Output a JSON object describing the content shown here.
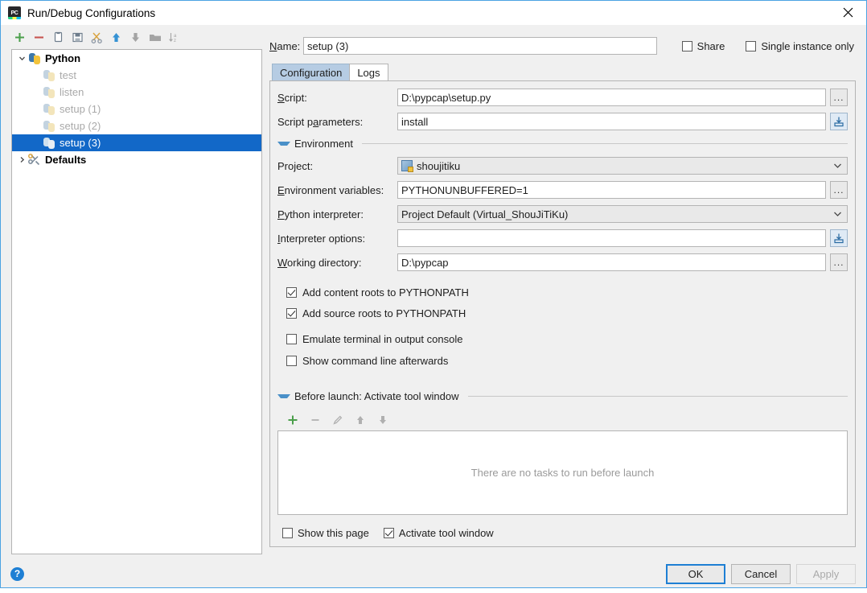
{
  "window": {
    "title": "Run/Debug Configurations",
    "app_icon": "pycharm-icon",
    "close_icon": "close-icon"
  },
  "tree_toolbar": {
    "items": [
      {
        "name": "add-configuration-button",
        "icon": "plus-icon",
        "color": "#4b9f4b",
        "enabled": true
      },
      {
        "name": "remove-configuration-button",
        "icon": "minus-icon",
        "color": "#c75450",
        "enabled": true
      },
      {
        "name": "copy-configuration-button",
        "icon": "copy-icon",
        "color": "#6e7d8c",
        "enabled": true
      },
      {
        "name": "save-configuration-button",
        "icon": "save-icon",
        "color": "#6e7d8c",
        "enabled": true
      },
      {
        "name": "edit-templates-button",
        "icon": "scissors-icon",
        "color": "#d9a441",
        "enabled": true
      },
      {
        "name": "move-up-button",
        "icon": "arrow-up-icon",
        "color": "#3592d4",
        "enabled": true
      },
      {
        "name": "move-down-button",
        "icon": "arrow-down-icon",
        "color": "#a4a4a4",
        "enabled": false
      },
      {
        "name": "move-into-folder-button",
        "icon": "folder-icon",
        "color": "#a4a4a4",
        "enabled": false
      },
      {
        "name": "sort-configurations-button",
        "icon": "sort-az-icon",
        "color": "#a4a4a4",
        "enabled": false
      }
    ]
  },
  "tree": {
    "nodes": [
      {
        "label": "Python",
        "type": "group",
        "expanded": true,
        "icon": "python-icon",
        "selected": false
      },
      {
        "label": "test",
        "type": "child",
        "icon": "python-icon",
        "selected": false
      },
      {
        "label": "listen",
        "type": "child",
        "icon": "python-icon",
        "selected": false
      },
      {
        "label": "setup (1)",
        "type": "child",
        "icon": "python-icon",
        "selected": false
      },
      {
        "label": "setup (2)",
        "type": "child",
        "icon": "python-icon",
        "selected": false
      },
      {
        "label": "setup (3)",
        "type": "child",
        "icon": "python-icon",
        "selected": true
      },
      {
        "label": "Defaults",
        "type": "group",
        "expanded": false,
        "icon": "wrench-icon",
        "selected": false
      }
    ]
  },
  "name_row": {
    "label": "Name:",
    "value": "setup (3)",
    "placeholder": "",
    "share": {
      "label": "Share",
      "checked": false
    },
    "single_instance": {
      "label": "Single instance only",
      "checked": false
    }
  },
  "tabs": [
    {
      "label": "Configuration",
      "active": true
    },
    {
      "label": "Logs",
      "active": false
    }
  ],
  "fields": {
    "script": {
      "label": "Script:",
      "value": "D:\\pypcap\\setup.py",
      "browse_icon": "ellipsis-icon",
      "browse_label": "..."
    },
    "script_parameters": {
      "label": "Script parameters:",
      "value": "install",
      "macro_icon": "expand-macros-icon"
    },
    "environment_section": {
      "label": "Environment",
      "expanded": true,
      "toggle_icon": "triangle-down-icon"
    },
    "project": {
      "label": "Project:",
      "value": "shoujitiku",
      "icon": "project-icon",
      "caret_icon": "chevron-down-icon"
    },
    "environment_variables": {
      "label": "Environment variables:",
      "value": "PYTHONUNBUFFERED=1",
      "browse_label": "..."
    },
    "python_interpreter": {
      "label": "Python interpreter:",
      "value": "Project Default (Virtual_ShouJiTiKu)",
      "caret_icon": "chevron-down-icon"
    },
    "interpreter_options": {
      "label": "Interpreter options:",
      "value": "",
      "macro_icon": "expand-macros-icon"
    },
    "working_directory": {
      "label": "Working directory:",
      "value": "D:\\pypcap",
      "browse_label": "..."
    }
  },
  "checkboxes": [
    {
      "label": "Add content roots to PYTHONPATH",
      "checked": true,
      "name": "add-content-roots-checkbox"
    },
    {
      "label": "Add source roots to PYTHONPATH",
      "checked": true,
      "name": "add-source-roots-checkbox"
    },
    {
      "label": "Emulate terminal in output console",
      "checked": false,
      "name": "emulate-terminal-checkbox"
    },
    {
      "label": "Show command line afterwards",
      "checked": false,
      "name": "show-command-line-checkbox"
    }
  ],
  "before_launch": {
    "title": "Before launch: Activate tool window",
    "toggle_icon": "triangle-down-icon",
    "toolbar": [
      {
        "name": "add-task-button",
        "icon": "plus-icon",
        "color": "#4b9f4b",
        "enabled": true
      },
      {
        "name": "remove-task-button",
        "icon": "minus-icon",
        "color": "#b8b8b8",
        "enabled": false
      },
      {
        "name": "edit-task-button",
        "icon": "pencil-icon",
        "color": "#b0b0b0",
        "enabled": false
      },
      {
        "name": "move-task-up-button",
        "icon": "arrow-up-icon",
        "color": "#b0b0b0",
        "enabled": false
      },
      {
        "name": "move-task-down-button",
        "icon": "arrow-down-icon",
        "color": "#b0b0b0",
        "enabled": false
      }
    ],
    "empty_text": "There are no tasks to run before launch",
    "show_this_page": {
      "label": "Show this page",
      "checked": false
    },
    "activate_tool_window": {
      "label": "Activate tool window",
      "checked": true
    }
  },
  "footer": {
    "help_icon": "help-icon",
    "help_glyph": "?",
    "buttons": [
      {
        "label": "OK",
        "name": "ok-button",
        "style": "primary",
        "enabled": true
      },
      {
        "label": "Cancel",
        "name": "cancel-button",
        "style": "normal",
        "enabled": true
      },
      {
        "label": "Apply",
        "name": "apply-button",
        "style": "disabled",
        "enabled": false
      }
    ]
  },
  "colors": {
    "selection_blue": "#1268c8",
    "accent_blue": "#1e7fd4",
    "tab_active": "#b6cce3",
    "dialog_bg": "#f0f0f0"
  }
}
